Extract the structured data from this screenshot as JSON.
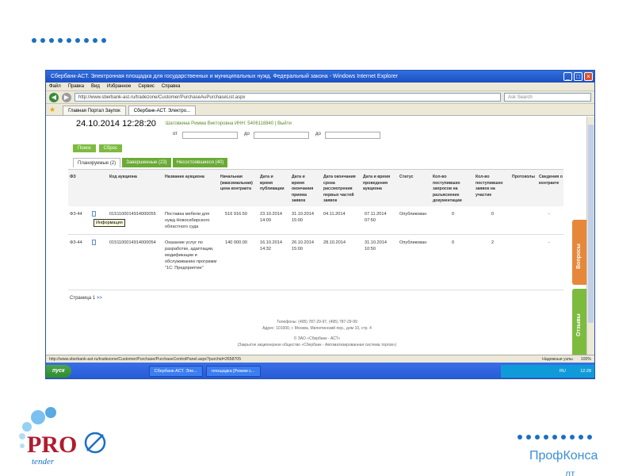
{
  "window": {
    "title": "Сбербанк-АСТ. Электронная площадка для государственных и муниципальных нужд. Федеральный закона - Windows Internet Explorer",
    "menu": [
      "Файл",
      "Правка",
      "Вид",
      "Избранное",
      "Сервис",
      "Справка"
    ],
    "url": "http://www.sberbank-ast.ru/tradezone/Customer/PurchaseAuPurchaseList.aspx",
    "search_placeholder": "Ask Search",
    "tabs": [
      "Главная Портал Заупок",
      "Сбербанк-АСТ. Электро..."
    ]
  },
  "header": {
    "date": "24.10.2014 12:28:20",
    "user": "Шатовкина Римма Викторовна ИНН: 5406118840 | Выйти",
    "filter_label_from": "от",
    "filter_label_to": "до"
  },
  "buttons": {
    "search": "Поиск",
    "reset": "Сброс"
  },
  "status_tabs": [
    "Планируемые (2)",
    "Завершенные (23)",
    "Несостоявшиеся (40)"
  ],
  "table": {
    "headers": [
      "ФЗ",
      "Код аукциона",
      "Название аукциона",
      "Начальная (максимальная) цена контракта",
      "Дата и время публикации",
      "Дата и время окончания приема заявок",
      "Дата окончания срока рассмотрения первых частей заявок",
      "Дата и время проведения аукциона",
      "Статус",
      "Кол-во поступивших запросов на разъяснение документации",
      "Кол-во поступивших заявок на участие",
      "Протоколы",
      "Сведения о контракте"
    ],
    "rows": [
      {
        "fz": "ФЗ-44",
        "code": "0151100014914000055",
        "name": "Поставка мебели для нужд Новосибирского областного суда",
        "price": "516 916.50",
        "published": "23.10.2014 14:09",
        "end_receipt": "31.10.2014 15:00",
        "end_review": "04.11.2014",
        "auction": "07.11.2014 07:50",
        "status": "Опубликован",
        "requests": "0",
        "bids": "0",
        "protocols": "",
        "contract": "-"
      },
      {
        "fz": "ФЗ-44",
        "code": "0151100014914000054",
        "name": "Оказание услуг по разработке, адаптации, модификации и обслуживанию программ \"1С: Предприятие\"",
        "price": "140 000.00",
        "published": "16.10.2014 14:32",
        "end_receipt": "26.10.2014 15:00",
        "end_review": "28.10.2014",
        "auction": "31.10.2014 10:50",
        "status": "Опубликован",
        "requests": "0",
        "bids": "2",
        "protocols": "",
        "contract": "-"
      }
    ],
    "tooltip": "Информация"
  },
  "pager": {
    "label": "Страница 1",
    "next": ">>"
  },
  "footer": {
    "line1": "Телефоны: (495) 787-29-97, (495) 787-29-99",
    "line2": "Адрес: 101000, г. Москва, Милютинский пер., дом 10, стр. 4",
    "line3": "© ЗАО «Сбербанк - АСТ»",
    "line4": "(Закрытое акционерное общество «Сбербанк - Автоматизированная система торгов»)"
  },
  "side_panel": {
    "questions": "Вопросы",
    "reviews": "Отзывы"
  },
  "statusbar": {
    "url": "http://www.sberbank-ast.ru/tradezone/Customer/Purchase/PurchaseControlPanel.aspx?purchid=2658705",
    "zone": "Надежные узлы",
    "zoom": "100%"
  },
  "taskbar": {
    "start": "пуск",
    "items": [
      "Сбербанк-АСТ. Эле...",
      "площадка [Режим с..."
    ],
    "lang": "RU",
    "clock": "12:28"
  },
  "brand": {
    "logo_text": "PRO",
    "logo_sub": "tender",
    "right_text": "ПрофКонса",
    "right_text2": "лт"
  },
  "colors": {
    "accent_blue": "#1b6fc4",
    "green": "#7dbb3f",
    "orange": "#e6883a",
    "logo_red": "#b11b2e"
  }
}
